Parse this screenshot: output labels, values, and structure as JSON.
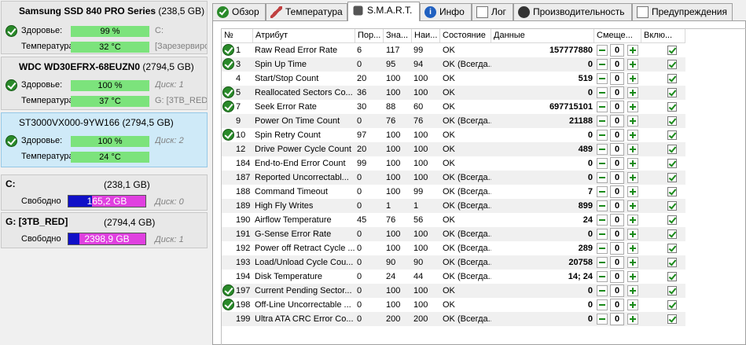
{
  "disks": [
    {
      "name": "Samsung SSD 840 PRO Series",
      "size": "(238,5 GB)",
      "health_label": "Здоровье:",
      "health": "99 %",
      "health_note": "C:",
      "temp_label": "Температура:",
      "temp": "32 °C",
      "temp_note": "[Зарезервировано]"
    },
    {
      "name": "WDC WD30EFRX-68EUZN0",
      "size": "(2794,5 GB)",
      "health_label": "Здоровье:",
      "health": "100 %",
      "health_note": "Диск: 1",
      "temp_label": "Температура:",
      "temp": "37 °C",
      "temp_note": "G: [3TB_RED]"
    },
    {
      "name": "ST3000VX000-9YW166",
      "size": "(2794,5 GB)",
      "health_label": "Здоровье:",
      "health": "100 %",
      "health_note": "Диск: 2",
      "temp_label": "Температура:",
      "temp": "24 °C",
      "temp_note": ""
    }
  ],
  "volumes": [
    {
      "name": "C:",
      "size": "(238,1 GB)",
      "free_label": "Свободно",
      "free": "165,2 GB",
      "fill_fraction": 0.31,
      "note": "Диск: 0"
    },
    {
      "name": "G: [3TB_RED]",
      "size": "(2794,4 GB)",
      "free_label": "Свободно",
      "free": "2398,9 GB",
      "fill_fraction": 0.14,
      "note": "Диск: 1"
    }
  ],
  "tabs": [
    {
      "label": "Обзор",
      "icon": "ok-icon"
    },
    {
      "label": "Температура",
      "icon": "thermometer-icon"
    },
    {
      "label": "S.M.A.R.T.",
      "icon": "smart-icon"
    },
    {
      "label": "Инфо",
      "icon": "info-icon"
    },
    {
      "label": "Лог",
      "icon": "log-icon"
    },
    {
      "label": "Производительность",
      "icon": "performance-icon"
    },
    {
      "label": "Предупреждения",
      "icon": "warnings-icon"
    }
  ],
  "smart": {
    "headers": [
      "№",
      "Атрибут",
      "Пор...",
      "Зна...",
      "Наи...",
      "Состояние",
      "Данные",
      "Смеще...",
      "Вклю..."
    ],
    "rows": [
      {
        "ok": true,
        "num": "1",
        "attr": "Raw Read Error Rate",
        "thr": "6",
        "val": "117",
        "worst": "99",
        "status": "OK",
        "data": "157777880",
        "offset": "0"
      },
      {
        "ok": true,
        "num": "3",
        "attr": "Spin Up Time",
        "thr": "0",
        "val": "95",
        "worst": "94",
        "status": "OK (Всегда...",
        "data": "0",
        "offset": "0"
      },
      {
        "ok": false,
        "num": "4",
        "attr": "Start/Stop Count",
        "thr": "20",
        "val": "100",
        "worst": "100",
        "status": "OK",
        "data": "519",
        "offset": "0"
      },
      {
        "ok": true,
        "num": "5",
        "attr": "Reallocated Sectors Co...",
        "thr": "36",
        "val": "100",
        "worst": "100",
        "status": "OK",
        "data": "0",
        "offset": "0"
      },
      {
        "ok": true,
        "num": "7",
        "attr": "Seek Error Rate",
        "thr": "30",
        "val": "88",
        "worst": "60",
        "status": "OK",
        "data": "697715101",
        "offset": "0"
      },
      {
        "ok": false,
        "num": "9",
        "attr": "Power On Time Count",
        "thr": "0",
        "val": "76",
        "worst": "76",
        "status": "OK (Всегда...",
        "data": "21188",
        "offset": "0"
      },
      {
        "ok": true,
        "num": "10",
        "attr": "Spin Retry Count",
        "thr": "97",
        "val": "100",
        "worst": "100",
        "status": "OK",
        "data": "0",
        "offset": "0"
      },
      {
        "ok": false,
        "num": "12",
        "attr": "Drive Power Cycle Count",
        "thr": "20",
        "val": "100",
        "worst": "100",
        "status": "OK",
        "data": "489",
        "offset": "0"
      },
      {
        "ok": false,
        "num": "184",
        "attr": "End-to-End Error Count",
        "thr": "99",
        "val": "100",
        "worst": "100",
        "status": "OK",
        "data": "0",
        "offset": "0"
      },
      {
        "ok": false,
        "num": "187",
        "attr": "Reported Uncorrectabl...",
        "thr": "0",
        "val": "100",
        "worst": "100",
        "status": "OK (Всегда...",
        "data": "0",
        "offset": "0"
      },
      {
        "ok": false,
        "num": "188",
        "attr": "Command Timeout",
        "thr": "0",
        "val": "100",
        "worst": "99",
        "status": "OK (Всегда...",
        "data": "7",
        "offset": "0"
      },
      {
        "ok": false,
        "num": "189",
        "attr": "High Fly Writes",
        "thr": "0",
        "val": "1",
        "worst": "1",
        "status": "OK (Всегда...",
        "data": "899",
        "offset": "0"
      },
      {
        "ok": false,
        "num": "190",
        "attr": "Airflow Temperature",
        "thr": "45",
        "val": "76",
        "worst": "56",
        "status": "OK",
        "data": "24",
        "offset": "0"
      },
      {
        "ok": false,
        "num": "191",
        "attr": "G-Sense Error Rate",
        "thr": "0",
        "val": "100",
        "worst": "100",
        "status": "OK (Всегда...",
        "data": "0",
        "offset": "0"
      },
      {
        "ok": false,
        "num": "192",
        "attr": "Power off Retract Cycle ...",
        "thr": "0",
        "val": "100",
        "worst": "100",
        "status": "OK (Всегда...",
        "data": "289",
        "offset": "0"
      },
      {
        "ok": false,
        "num": "193",
        "attr": "Load/Unload Cycle Cou...",
        "thr": "0",
        "val": "90",
        "worst": "90",
        "status": "OK (Всегда...",
        "data": "20758",
        "offset": "0"
      },
      {
        "ok": false,
        "num": "194",
        "attr": "Disk Temperature",
        "thr": "0",
        "val": "24",
        "worst": "44",
        "status": "OK (Всегда...",
        "data": "14; 24",
        "offset": "0"
      },
      {
        "ok": true,
        "num": "197",
        "attr": "Current Pending Sector...",
        "thr": "0",
        "val": "100",
        "worst": "100",
        "status": "OK",
        "data": "0",
        "offset": "0"
      },
      {
        "ok": true,
        "num": "198",
        "attr": "Off-Line Uncorrectable ...",
        "thr": "0",
        "val": "100",
        "worst": "100",
        "status": "OK",
        "data": "0",
        "offset": "0"
      },
      {
        "ok": false,
        "num": "199",
        "attr": "Ultra ATA CRC Error Co...",
        "thr": "0",
        "val": "200",
        "worst": "200",
        "status": "OK (Всегда...",
        "data": "0",
        "offset": "0"
      }
    ]
  },
  "colors": {
    "health_bar": "#7ce37c",
    "free_bar": "#1010c8",
    "used_bar": "#e040e0",
    "ok_icon": "#2a8a2a",
    "selected_disk": "#cfeaf8"
  }
}
